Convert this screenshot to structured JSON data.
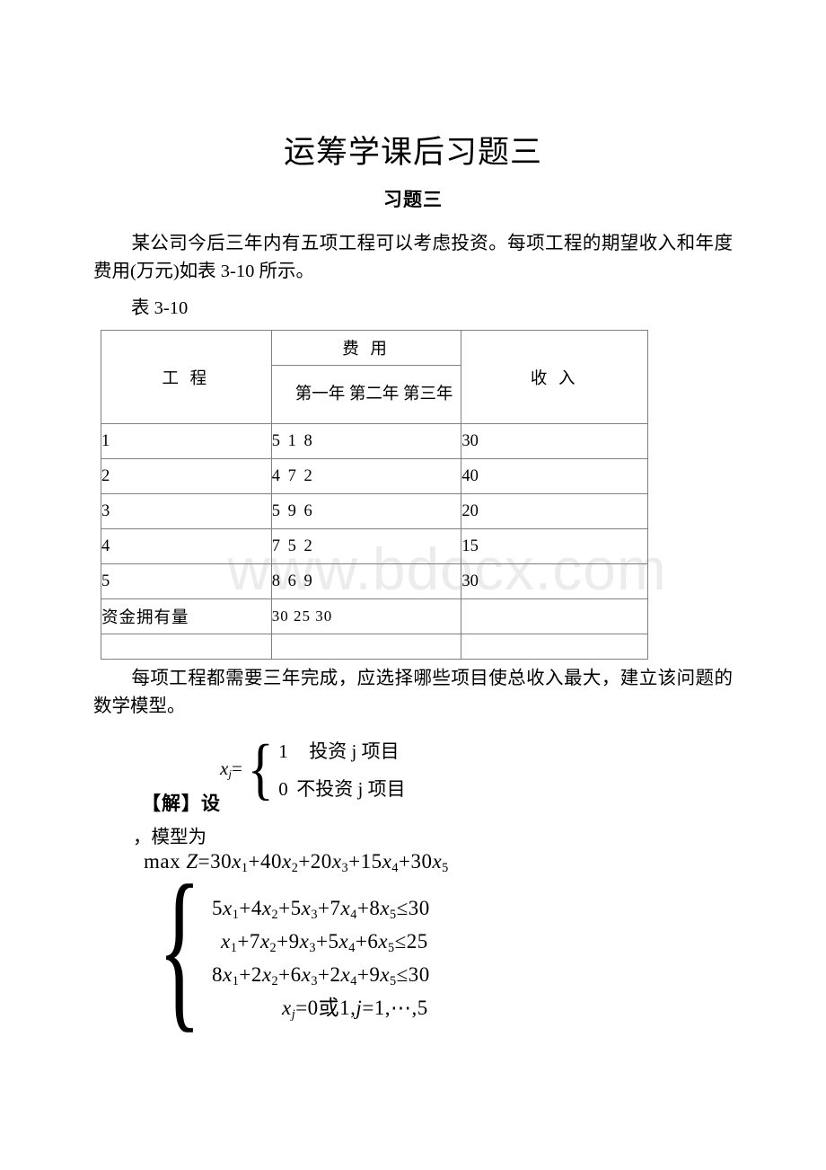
{
  "document": {
    "title": "运筹学课后习题三",
    "subtitle": "习题三",
    "watermark": "www.bdocx.com"
  },
  "intro_paragraph": "某公司今后三年内有五项工程可以考虑投资。每项工程的期望收入和年度费用(万元)如表 3-10 所示。",
  "table_caption": "表 3-10",
  "table": {
    "headers": {
      "project": "工 程",
      "cost_group": "费 用",
      "years": "第一年 第二年 第三年",
      "income": "收 入"
    },
    "rows": [
      {
        "project": "1",
        "cost": "5 1 8",
        "income": "30"
      },
      {
        "project": "2",
        "cost": "4 7 2",
        "income": "40"
      },
      {
        "project": "3",
        "cost": "5 9 6",
        "income": "20"
      },
      {
        "project": "4",
        "cost": "7 5 2",
        "income": "15"
      },
      {
        "project": "5",
        "cost": "8 6 9",
        "income": "30"
      }
    ],
    "total_row": {
      "label": "资金拥有量",
      "cost": "30 25 30",
      "income": ""
    },
    "empty_row": {
      "project": "",
      "cost": "",
      "income": ""
    }
  },
  "question_paragraph": "每项工程都需要三年完成，应选择哪些项目使总收入最大，建立该问题的数学模型。",
  "solution": {
    "solve_label": "【解】设",
    "model_label": "，模型为",
    "xj_variable": "x",
    "xj_subscript": "j",
    "xj_equals": "=",
    "case_1_value": "1",
    "case_1_text": "投资 j 项目",
    "case_0_value": "0",
    "case_0_text": "不投资 j 项目",
    "objective": {
      "prefix": "max",
      "z": "Z",
      "equals": "=",
      "terms": [
        {
          "coef": "30",
          "var": "x",
          "sub": "1"
        },
        {
          "coef": "40",
          "var": "x",
          "sub": "2"
        },
        {
          "coef": "20",
          "var": "x",
          "sub": "3"
        },
        {
          "coef": "15",
          "var": "x",
          "sub": "4"
        },
        {
          "coef": "30",
          "var": "x",
          "sub": "5"
        }
      ]
    },
    "constraints": [
      {
        "coefs": [
          "5",
          "4",
          "5",
          "7",
          "8"
        ],
        "relation": "≤",
        "rhs": "30"
      },
      {
        "coefs": [
          "",
          "7",
          "9",
          "5",
          "6"
        ],
        "relation": "≤",
        "rhs": "25"
      },
      {
        "coefs": [
          "8",
          "2",
          "6",
          "2",
          "9"
        ],
        "relation": "≤",
        "rhs": "30"
      }
    ],
    "integrality": "x_j = 0 或 1, j = 1, ⋯, 5",
    "integrality_parts": {
      "var": "x",
      "sub": "j",
      "eq": "=",
      "zero": "0",
      "or": "或",
      "one": "1",
      "comma": ",",
      "j": "j",
      "eq2": "=",
      "one2": "1",
      "dots": "⋯",
      "five": "5"
    }
  }
}
